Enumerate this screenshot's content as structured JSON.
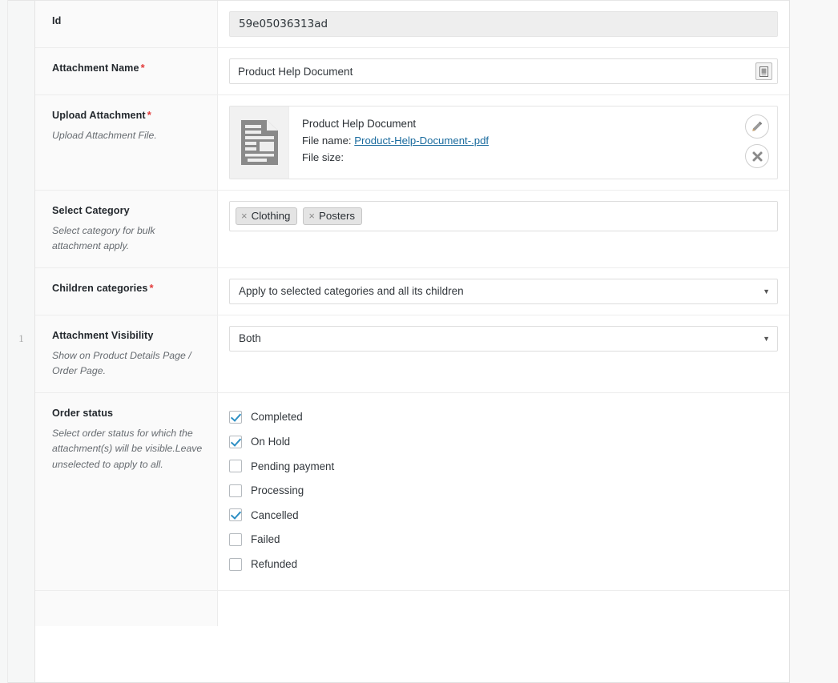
{
  "row_number": "1",
  "fields": {
    "id": {
      "label": "Id",
      "value": "59e05036313ad"
    },
    "attachment_name": {
      "label": "Attachment Name",
      "required": "*",
      "value": "Product Help Document",
      "button_icon": "media-library-icon"
    },
    "upload_attachment": {
      "label": "Upload Attachment",
      "required": "*",
      "hint": "Upload Attachment File.",
      "file_title": "Product Help Document",
      "file_name_label": "File name:",
      "file_name": "Product-Help-Document-.pdf",
      "file_size_label": "File size:",
      "file_size": "",
      "edit_icon": "pencil-icon",
      "remove_icon": "close-icon"
    },
    "select_category": {
      "label": "Select Category",
      "hint": "Select category for bulk attachment apply.",
      "tags": [
        {
          "label": "Clothing",
          "remove": "×"
        },
        {
          "label": "Posters",
          "remove": "×"
        }
      ]
    },
    "children_categories": {
      "label": "Children categories",
      "required": "*",
      "selected": "Apply to selected categories and all its children",
      "caret": "▼"
    },
    "attachment_visibility": {
      "label": "Attachment Visibility",
      "hint": "Show on Product Details Page / Order Page.",
      "selected": "Both",
      "caret": "▼"
    },
    "order_status": {
      "label": "Order status",
      "hint": "Select order status for which the attachment(s) will be visible.Leave unselected to apply to all.",
      "options": [
        {
          "label": "Completed",
          "checked": true
        },
        {
          "label": "On Hold",
          "checked": true
        },
        {
          "label": "Pending payment",
          "checked": false
        },
        {
          "label": "Processing",
          "checked": false
        },
        {
          "label": "Cancelled",
          "checked": true
        },
        {
          "label": "Failed",
          "checked": false
        },
        {
          "label": "Refunded",
          "checked": false
        }
      ]
    }
  },
  "colors": {
    "required": "#e23a3a",
    "link": "#1a6b9e",
    "checkmark": "#2d8fc4",
    "label_bg": "#fafafa",
    "readonly_bg": "#eeeeee"
  }
}
